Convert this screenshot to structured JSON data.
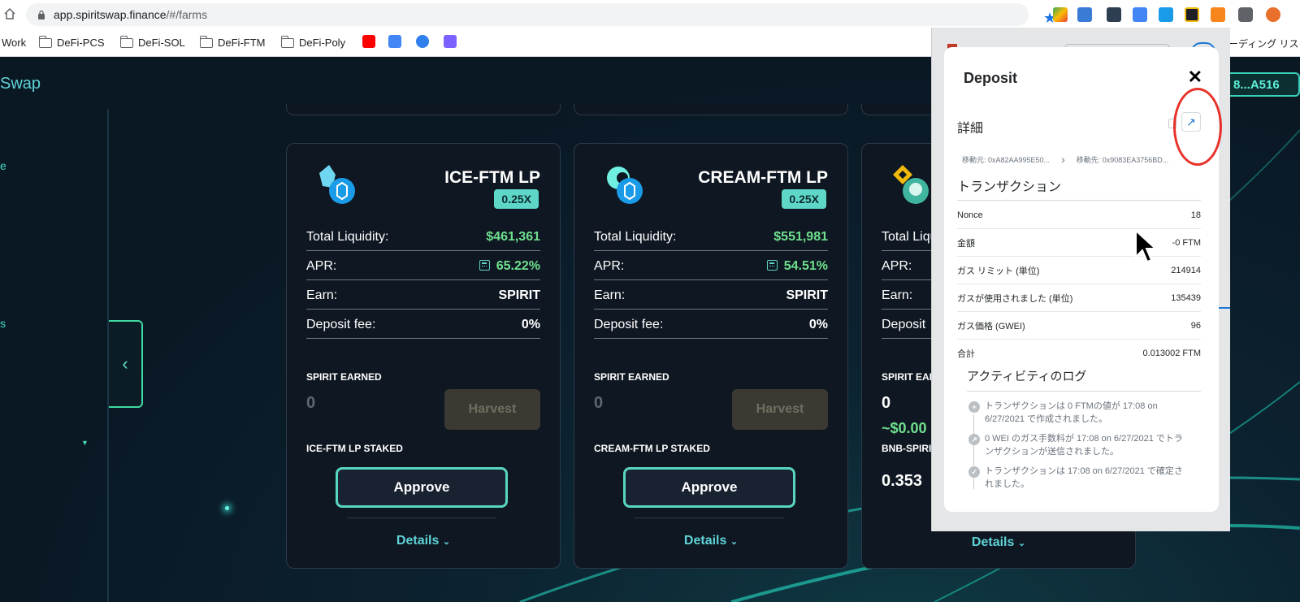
{
  "browser": {
    "url_host": "app.spiritswap.finance",
    "url_path": "/#/farms",
    "bookmarks": [
      "Work",
      "DeFi-PCS",
      "DeFi-SOL",
      "DeFi-FTM",
      "DeFi-Poly"
    ],
    "bookmarks_overflow": "ーディング リス"
  },
  "app": {
    "brand_fragment": "Swap",
    "wallet_fragment": "8...A516",
    "sidebar_fragments": [
      "e",
      "s"
    ]
  },
  "cards": [
    {
      "title": "ICE-FTM LP",
      "multiplier": "0.25X",
      "total_liquidity_label": "Total Liquidity:",
      "total_liquidity": "$461,361",
      "apr_label": "APR:",
      "apr": "65.22%",
      "earn_label": "Earn:",
      "earn": "SPIRIT",
      "fee_label": "Deposit fee:",
      "fee": "0%",
      "earned_label": "SPIRIT EARNED",
      "earned_value": "0",
      "harvest_label": "Harvest",
      "staked_label": "ICE-FTM LP STAKED",
      "approve_label": "Approve",
      "details_label": "Details"
    },
    {
      "title": "CREAM-FTM LP",
      "multiplier": "0.25X",
      "total_liquidity_label": "Total Liquidity:",
      "total_liquidity": "$551,981",
      "apr_label": "APR:",
      "apr": "54.51%",
      "earn_label": "Earn:",
      "earn": "SPIRIT",
      "fee_label": "Deposit fee:",
      "fee": "0%",
      "earned_label": "SPIRIT EARNED",
      "earned_value": "0",
      "harvest_label": "Harvest",
      "staked_label": "CREAM-FTM LP STAKED",
      "approve_label": "Approve",
      "details_label": "Details"
    },
    {
      "total_liquidity_label": "Total Liqu",
      "apr_label": "APR:",
      "earn_label": "Earn:",
      "fee_label": "Deposit",
      "earned_label": "SPIRIT EAI",
      "earned_value": "0",
      "earned_usd": "~$0.00",
      "staked_label": "BNB-SPIRI",
      "staked_value": "0.353",
      "details_label": "Details"
    }
  ],
  "metamask": {
    "title": "Deposit",
    "close": "✕",
    "details_heading": "詳細",
    "from": "移動元: 0xA82AA995E50...",
    "to": "移動先: 0x9083EA3756BD...",
    "tx_heading": "トランザクション",
    "tx_rows": [
      {
        "label": "Nonce",
        "value": "18"
      },
      {
        "label": "金額",
        "value": "-0 FTM"
      },
      {
        "label": "ガス リミット (単位)",
        "value": "214914"
      },
      {
        "label": "ガスが使用されました (単位)",
        "value": "135439"
      },
      {
        "label": "ガス価格 (GWEI)",
        "value": "96"
      },
      {
        "label": "合計",
        "value": "0.013002 FTM"
      }
    ],
    "log_heading": "アクティビティのログ",
    "log": [
      "トランザクションは 0 FTMの値が 17:08 on 6/27/2021 で作成されました。",
      "0 WEI のガス手数料が 17:08 on 6/27/2021 でトランザクションが送信されました。",
      "トランザクションは 17:08 on 6/27/2021 で確定されました。"
    ]
  },
  "colors": {
    "accent_teal": "#5fd3d6",
    "green_value": "#6fe08e",
    "annotation_red": "#e8322a"
  }
}
